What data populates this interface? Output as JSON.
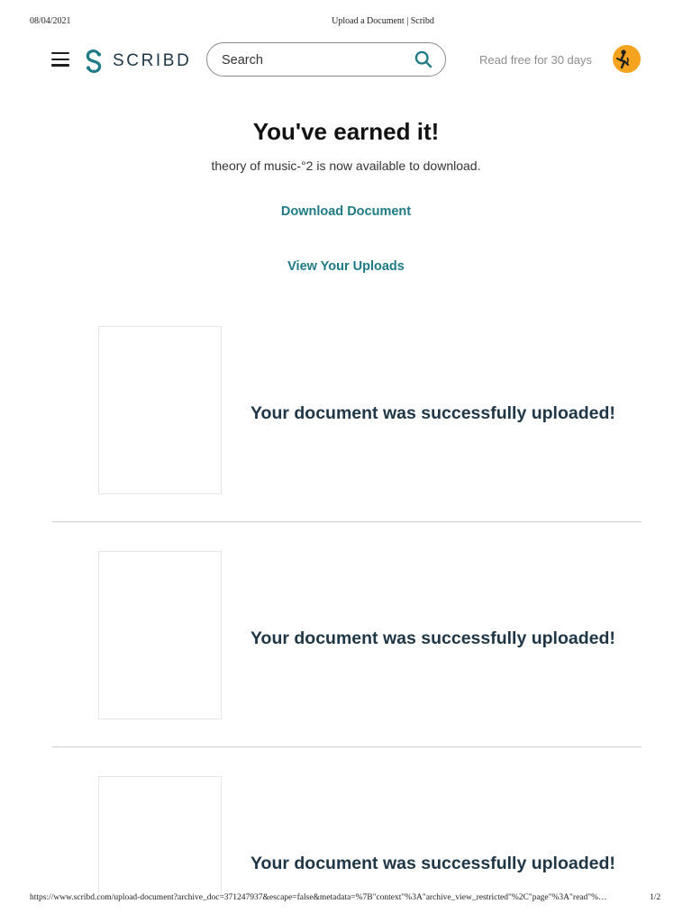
{
  "print": {
    "date": "08/04/2021",
    "title": "Upload a Document | Scribd",
    "url": "https://www.scribd.com/upload-document?archive_doc=371247937&escape=false&metadata=%7B\"context\"%3A\"archive_view_restricted\"%2C\"page\"%3A\"read\"%…",
    "page": "1/2"
  },
  "header": {
    "logo_text": "SCRIBD",
    "search_placeholder": "Search",
    "search_value": "",
    "read_free": "Read free for 30 days"
  },
  "main": {
    "title": "You've earned it!",
    "subtitle": "theory of music-°2 is now available to download.",
    "download_link": "Download Document",
    "uploads_link": "View Your Uploads"
  },
  "uploads": [
    {
      "message": "Your document was successfully uploaded!"
    },
    {
      "message": "Your document was successfully uploaded!"
    },
    {
      "message": "Your document was successfully uploaded!"
    }
  ],
  "colors": {
    "brand": "#1e3646",
    "link": "#1e7b85",
    "avatar_bg": "#f6a41f"
  },
  "icons": [
    "menu-icon",
    "scribd-logo-icon",
    "search-icon",
    "avatar"
  ]
}
